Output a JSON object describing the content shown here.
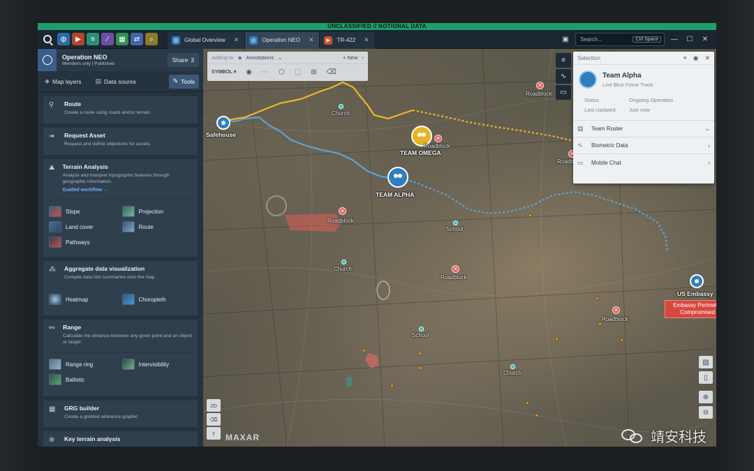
{
  "banner": "UNCLASSIFIED // NOTIONAL DATA",
  "tabs": [
    {
      "label": "Global Overview",
      "icon": "globe-icon",
      "color": "#2d7fc1"
    },
    {
      "label": "Operation NEO",
      "icon": "globe-icon",
      "color": "#2d7fc1"
    },
    {
      "label": "TR-422",
      "icon": "video-icon",
      "color": "#d14b2a"
    }
  ],
  "search": {
    "placeholder": "Search...",
    "shortcut": "Ctrl Space"
  },
  "operation": {
    "title": "Operation NEO",
    "subtitle": "Members only | Published",
    "share_label": "Share",
    "share_count": "3"
  },
  "left_tabs": [
    {
      "label": "Map layers",
      "icon": "layers-icon"
    },
    {
      "label": "Data soures",
      "icon": "database-icon"
    },
    {
      "label": "Tools",
      "icon": "wrench-icon"
    }
  ],
  "tools": {
    "route": {
      "title": "Route",
      "desc": "Create a route using roads and/or terrain."
    },
    "request": {
      "title": "Request Asset",
      "desc": "Request and define objectives for assets."
    },
    "terrain": {
      "title": "Terrain Analysis",
      "desc": "Analyze and interpret topographic features through geographic information.",
      "link": "Guided workflow",
      "items": [
        "Slope",
        "Projection",
        "Land cover",
        "Route",
        "Pathways"
      ]
    },
    "aggregate": {
      "title": "Aggregate data visualization",
      "desc": "Compile data into summaries onto the map.",
      "items": [
        "Heatmap",
        "Choropleth"
      ]
    },
    "range": {
      "title": "Range",
      "desc": "Calculate the distance between any given point and an object or target.",
      "items": [
        "Range ring",
        "Intervisibility",
        "Ballistic"
      ]
    },
    "grg": {
      "title": "GRG builder",
      "desc": "Create a gridded reference graphic"
    },
    "key_terrain": {
      "title": "Key terrain analysis"
    }
  },
  "annotation_bar": {
    "adding_to": "Adding to",
    "layer": "Annotations",
    "new_label": "New",
    "symbol_label": "SYMBOL"
  },
  "map": {
    "safehouse": "Safehouse",
    "team_alpha": "TEAM ALPHA",
    "team_omega": "TEAM OMEGA",
    "us_embassy": "US Embassy",
    "alert": "Embassy Perimeter Compromised",
    "labels": {
      "church": "Church",
      "school": "School",
      "roadblock": "Roadblock"
    },
    "attribution": "MAXAR",
    "view_mode": "2D",
    "colors": {
      "team_alpha": "#2d7fc1",
      "team_omega": "#e8b326",
      "route_alpha": "#5aa3d8",
      "route_omega": "#f0b429",
      "alert": "#d9473f",
      "poi": "#29c3c0"
    }
  },
  "selection": {
    "header": "Selection",
    "name": "Team Alpha",
    "sub": "Live Blue Force Track",
    "status_label": "Status",
    "status_value": "Ongoing Operation",
    "updated_label": "Last Updated",
    "updated_value": "Just now",
    "rows": [
      "Team Roster",
      "Biometric Data",
      "Mobile Chat"
    ]
  },
  "watermark": "靖安科技"
}
